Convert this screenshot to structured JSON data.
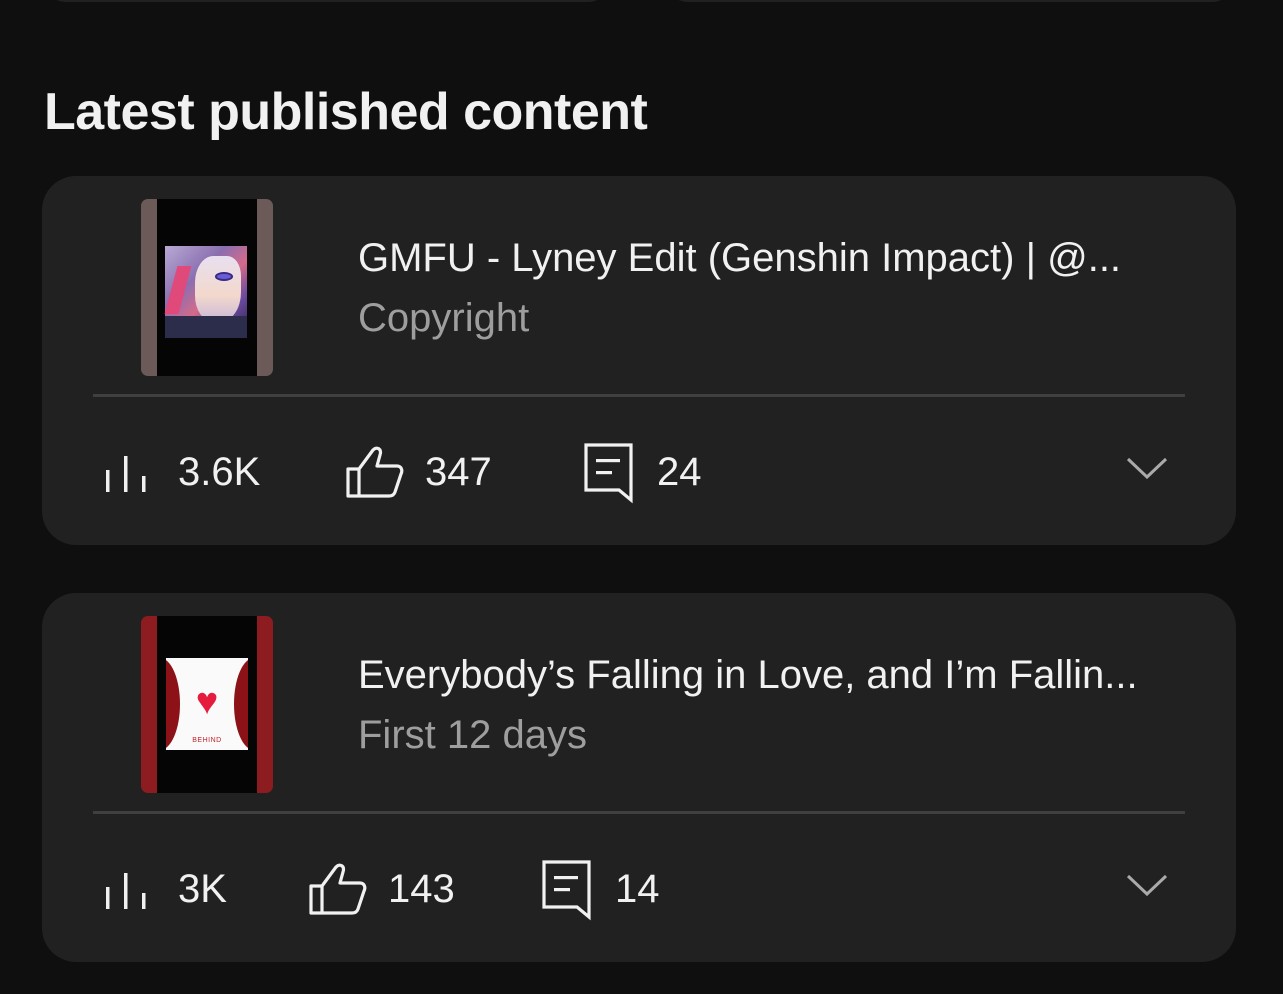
{
  "section_title": "Latest published content",
  "items": [
    {
      "title": "GMFU - Lyney Edit (Genshin Impact) | @...",
      "subtitle": "Copyright",
      "views": "3.6K",
      "likes": "347",
      "comments": "24",
      "thumbnail_icon": "anime-character-thumbnail"
    },
    {
      "title": "Everybody’s Falling in Love, and I’m Fallin...",
      "subtitle": "First 12 days",
      "views": "3K",
      "likes": "143",
      "comments": "14",
      "thumbnail_icon": "heart-card-thumbnail",
      "thumbnail_text": "BEHIND"
    }
  ],
  "icons": {
    "views": "bar-chart-icon",
    "likes": "thumbs-up-icon",
    "comments": "comment-icon",
    "expand": "chevron-down-icon"
  },
  "colors": {
    "background": "#0f0f0f",
    "card": "#212121",
    "text_primary": "#f1f1f1",
    "text_secondary": "#9e9e9e"
  }
}
